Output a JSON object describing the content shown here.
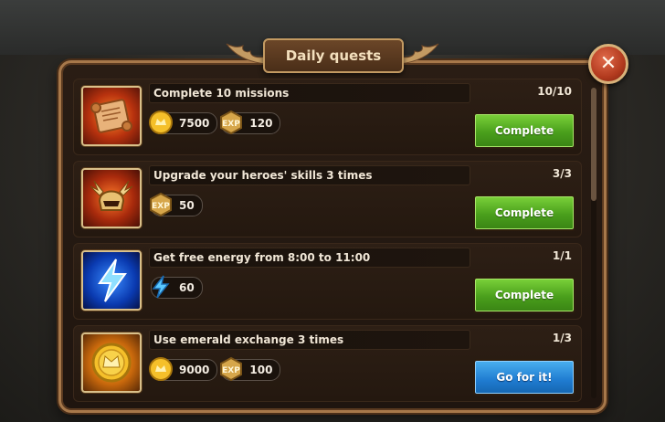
{
  "dialog": {
    "title": "Daily quests",
    "close_icon": "close-icon"
  },
  "quests": [
    {
      "title": "Complete 10 missions",
      "progress": "10/10",
      "icon": "scroll-icon",
      "rewards": [
        {
          "type": "gold",
          "icon": "gold-coin-icon",
          "value": "7500"
        },
        {
          "type": "exp",
          "icon": "exp-icon",
          "value": "120"
        }
      ],
      "action": {
        "label": "Complete",
        "style": "green"
      }
    },
    {
      "title": "Upgrade your heroes' skills 3 times",
      "progress": "3/3",
      "icon": "helmet-icon",
      "rewards": [
        {
          "type": "exp",
          "icon": "exp-icon",
          "value": "50"
        }
      ],
      "action": {
        "label": "Complete",
        "style": "green"
      }
    },
    {
      "title": "Get free energy from 8:00 to 11:00",
      "progress": "1/1",
      "icon": "lightning-icon",
      "rewards": [
        {
          "type": "energy",
          "icon": "energy-icon",
          "value": "60"
        }
      ],
      "action": {
        "label": "Complete",
        "style": "green"
      }
    },
    {
      "title": "Use emerald exchange 3 times",
      "progress": "1/3",
      "icon": "crown-coin-icon",
      "rewards": [
        {
          "type": "gold",
          "icon": "gold-coin-icon",
          "value": "9000"
        },
        {
          "type": "exp",
          "icon": "exp-icon",
          "value": "100"
        }
      ],
      "action": {
        "label": "Go for it!",
        "style": "blue"
      }
    }
  ],
  "exp_badge_text": "EXP",
  "colors": {
    "panel_border": "#a7784a",
    "complete_green": "#4a9f1c",
    "go_blue": "#1f7bd0",
    "close_red": "#b23a1e"
  }
}
